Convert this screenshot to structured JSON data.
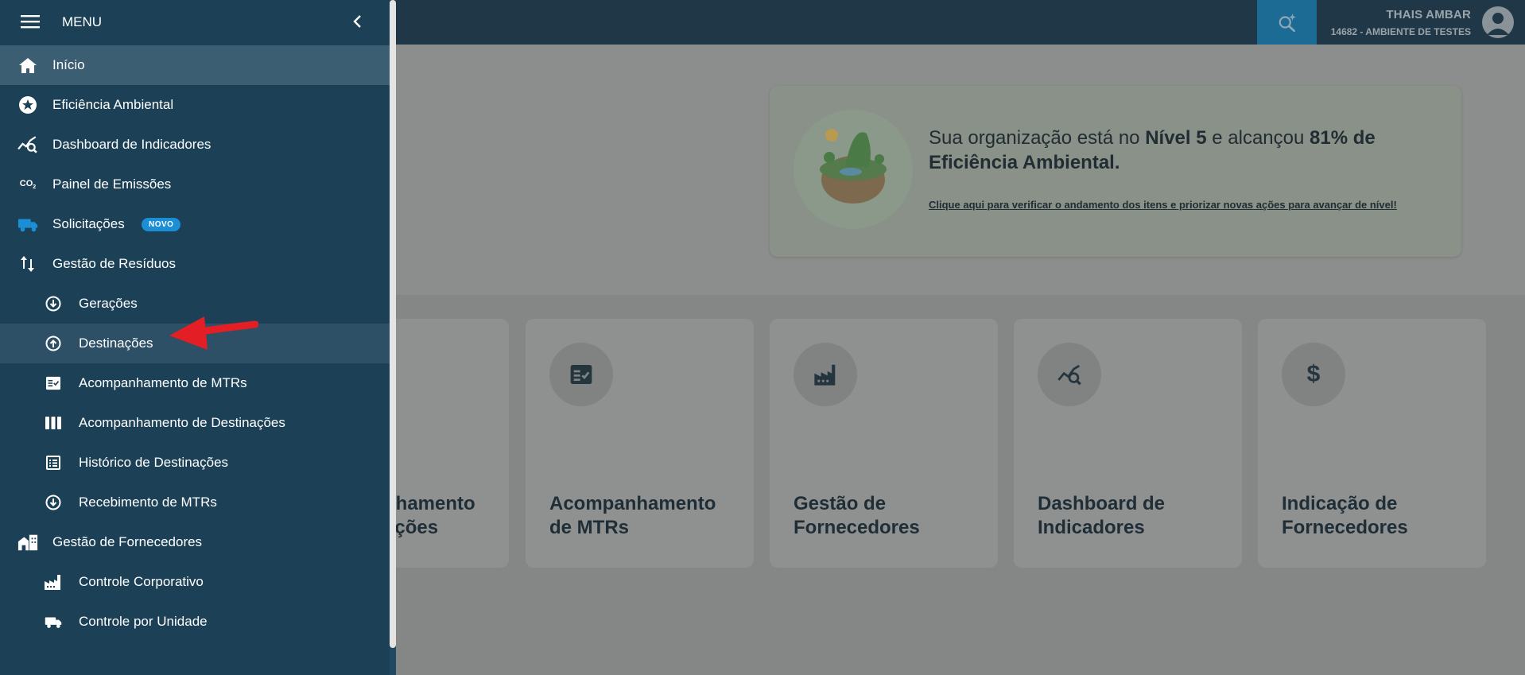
{
  "topbar": {
    "user_name": "THAIS AMBAR",
    "user_sub": "14682 - AMBIENTE DE TESTES",
    "icons": [
      "search-sparkle-icon",
      "user-avatar-icon"
    ]
  },
  "sidebar": {
    "title": "MENU",
    "items": [
      {
        "label": "Início",
        "icon": "home-icon"
      },
      {
        "label": "Eficiência Ambiental",
        "icon": "star-circle-icon"
      },
      {
        "label": "Dashboard de Indicadores",
        "icon": "chart-search-icon"
      },
      {
        "label": "Painel de Emissões",
        "icon": "co2-icon"
      },
      {
        "label": "Solicitações",
        "icon": "truck-icon",
        "badge": "NOVO"
      },
      {
        "label": "Gestão de Resíduos",
        "icon": "swap-vertical-icon"
      },
      {
        "label": "Gerações",
        "icon": "arrow-down-circle-icon"
      },
      {
        "label": "Destinações",
        "icon": "arrow-up-circle-icon"
      },
      {
        "label": "Acompanhamento de MTRs",
        "icon": "checklist-icon"
      },
      {
        "label": "Acompanhamento de Destinações",
        "icon": "columns-icon"
      },
      {
        "label": "Histórico de Destinações",
        "icon": "list-alt-icon"
      },
      {
        "label": "Recebimento de MTRs",
        "icon": "arrow-down-circle-icon"
      },
      {
        "label": "Gestão de Fornecedores",
        "icon": "buildings-icon"
      },
      {
        "label": "Controle Corporativo",
        "icon": "factory-icon"
      },
      {
        "label": "Controle por Unidade",
        "icon": "truck-small-icon"
      }
    ]
  },
  "level_card": {
    "text_1": "Sua organização está no ",
    "level": "Nível 5",
    "text_2": " e alcançou ",
    "percent": "81% de Eficiência Ambiental.",
    "link": "Clique aqui para verificar o andamento dos itens e priorizar novas ações para avançar de nível!"
  },
  "cards": [
    {
      "title": "nhamento\nações",
      "icon": ""
    },
    {
      "title": "Acompanhamento de MTRs",
      "icon": "checklist-icon"
    },
    {
      "title": "Gestão de Fornecedores",
      "icon": "factory-icon"
    },
    {
      "title": "Dashboard de Indicadores",
      "icon": "chart-search-icon"
    },
    {
      "title": "Indicação de Fornecedores",
      "icon": "dollar-icon"
    }
  ],
  "colors": {
    "sidebar_bg": "#1c4157",
    "topbar_bg": "#1f3746",
    "accent_blue": "#1a8fd6",
    "arrow_red": "#e31e24"
  }
}
